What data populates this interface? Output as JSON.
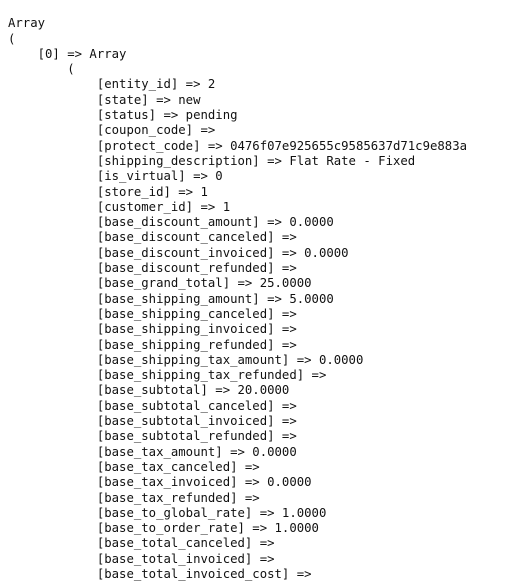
{
  "dump": {
    "type": "php-print-r",
    "root_label": "Array",
    "open_paren": "(",
    "indent_unit": "    ",
    "element_key": "[0]",
    "arrow": "=>",
    "element_label": "Array",
    "lines": [
      "Array",
      "(",
      "    [0] => Array",
      "        (",
      "            [entity_id] => 2",
      "            [state] => new",
      "            [status] => pending",
      "            [coupon_code] => ",
      "            [protect_code] => 0476f07e925655c9585637d71c9e883a",
      "            [shipping_description] => Flat Rate - Fixed",
      "            [is_virtual] => 0",
      "            [store_id] => 1",
      "            [customer_id] => 1",
      "            [base_discount_amount] => 0.0000",
      "            [base_discount_canceled] => ",
      "            [base_discount_invoiced] => 0.0000",
      "            [base_discount_refunded] => ",
      "            [base_grand_total] => 25.0000",
      "            [base_shipping_amount] => 5.0000",
      "            [base_shipping_canceled] => ",
      "            [base_shipping_invoiced] => ",
      "            [base_shipping_refunded] => ",
      "            [base_shipping_tax_amount] => 0.0000",
      "            [base_shipping_tax_refunded] => ",
      "            [base_subtotal] => 20.0000",
      "            [base_subtotal_canceled] => ",
      "            [base_subtotal_invoiced] => ",
      "            [base_subtotal_refunded] => ",
      "            [base_tax_amount] => 0.0000",
      "            [base_tax_canceled] => ",
      "            [base_tax_invoiced] => 0.0000",
      "            [base_tax_refunded] => ",
      "            [base_to_global_rate] => 1.0000",
      "            [base_to_order_rate] => 1.0000",
      "            [base_total_canceled] => ",
      "            [base_total_invoiced] => ",
      "            [base_total_invoiced_cost] => "
    ],
    "entries": [
      {
        "key": "entity_id",
        "value": "2"
      },
      {
        "key": "state",
        "value": "new"
      },
      {
        "key": "status",
        "value": "pending"
      },
      {
        "key": "coupon_code",
        "value": ""
      },
      {
        "key": "protect_code",
        "value": "0476f07e925655c9585637d71c9e883a"
      },
      {
        "key": "shipping_description",
        "value": "Flat Rate - Fixed"
      },
      {
        "key": "is_virtual",
        "value": "0"
      },
      {
        "key": "store_id",
        "value": "1"
      },
      {
        "key": "customer_id",
        "value": "1"
      },
      {
        "key": "base_discount_amount",
        "value": "0.0000"
      },
      {
        "key": "base_discount_canceled",
        "value": ""
      },
      {
        "key": "base_discount_invoiced",
        "value": "0.0000"
      },
      {
        "key": "base_discount_refunded",
        "value": ""
      },
      {
        "key": "base_grand_total",
        "value": "25.0000"
      },
      {
        "key": "base_shipping_amount",
        "value": "5.0000"
      },
      {
        "key": "base_shipping_canceled",
        "value": ""
      },
      {
        "key": "base_shipping_invoiced",
        "value": ""
      },
      {
        "key": "base_shipping_refunded",
        "value": ""
      },
      {
        "key": "base_shipping_tax_amount",
        "value": "0.0000"
      },
      {
        "key": "base_shipping_tax_refunded",
        "value": ""
      },
      {
        "key": "base_subtotal",
        "value": "20.0000"
      },
      {
        "key": "base_subtotal_canceled",
        "value": ""
      },
      {
        "key": "base_subtotal_invoiced",
        "value": ""
      },
      {
        "key": "base_subtotal_refunded",
        "value": ""
      },
      {
        "key": "base_tax_amount",
        "value": "0.0000"
      },
      {
        "key": "base_tax_canceled",
        "value": ""
      },
      {
        "key": "base_tax_invoiced",
        "value": "0.0000"
      },
      {
        "key": "base_tax_refunded",
        "value": ""
      },
      {
        "key": "base_to_global_rate",
        "value": "1.0000"
      },
      {
        "key": "base_to_order_rate",
        "value": "1.0000"
      },
      {
        "key": "base_total_canceled",
        "value": ""
      },
      {
        "key": "base_total_invoiced",
        "value": ""
      },
      {
        "key": "base_total_invoiced_cost",
        "value": ""
      }
    ],
    "text_color": "#111111",
    "background_color": "#ffffff"
  }
}
